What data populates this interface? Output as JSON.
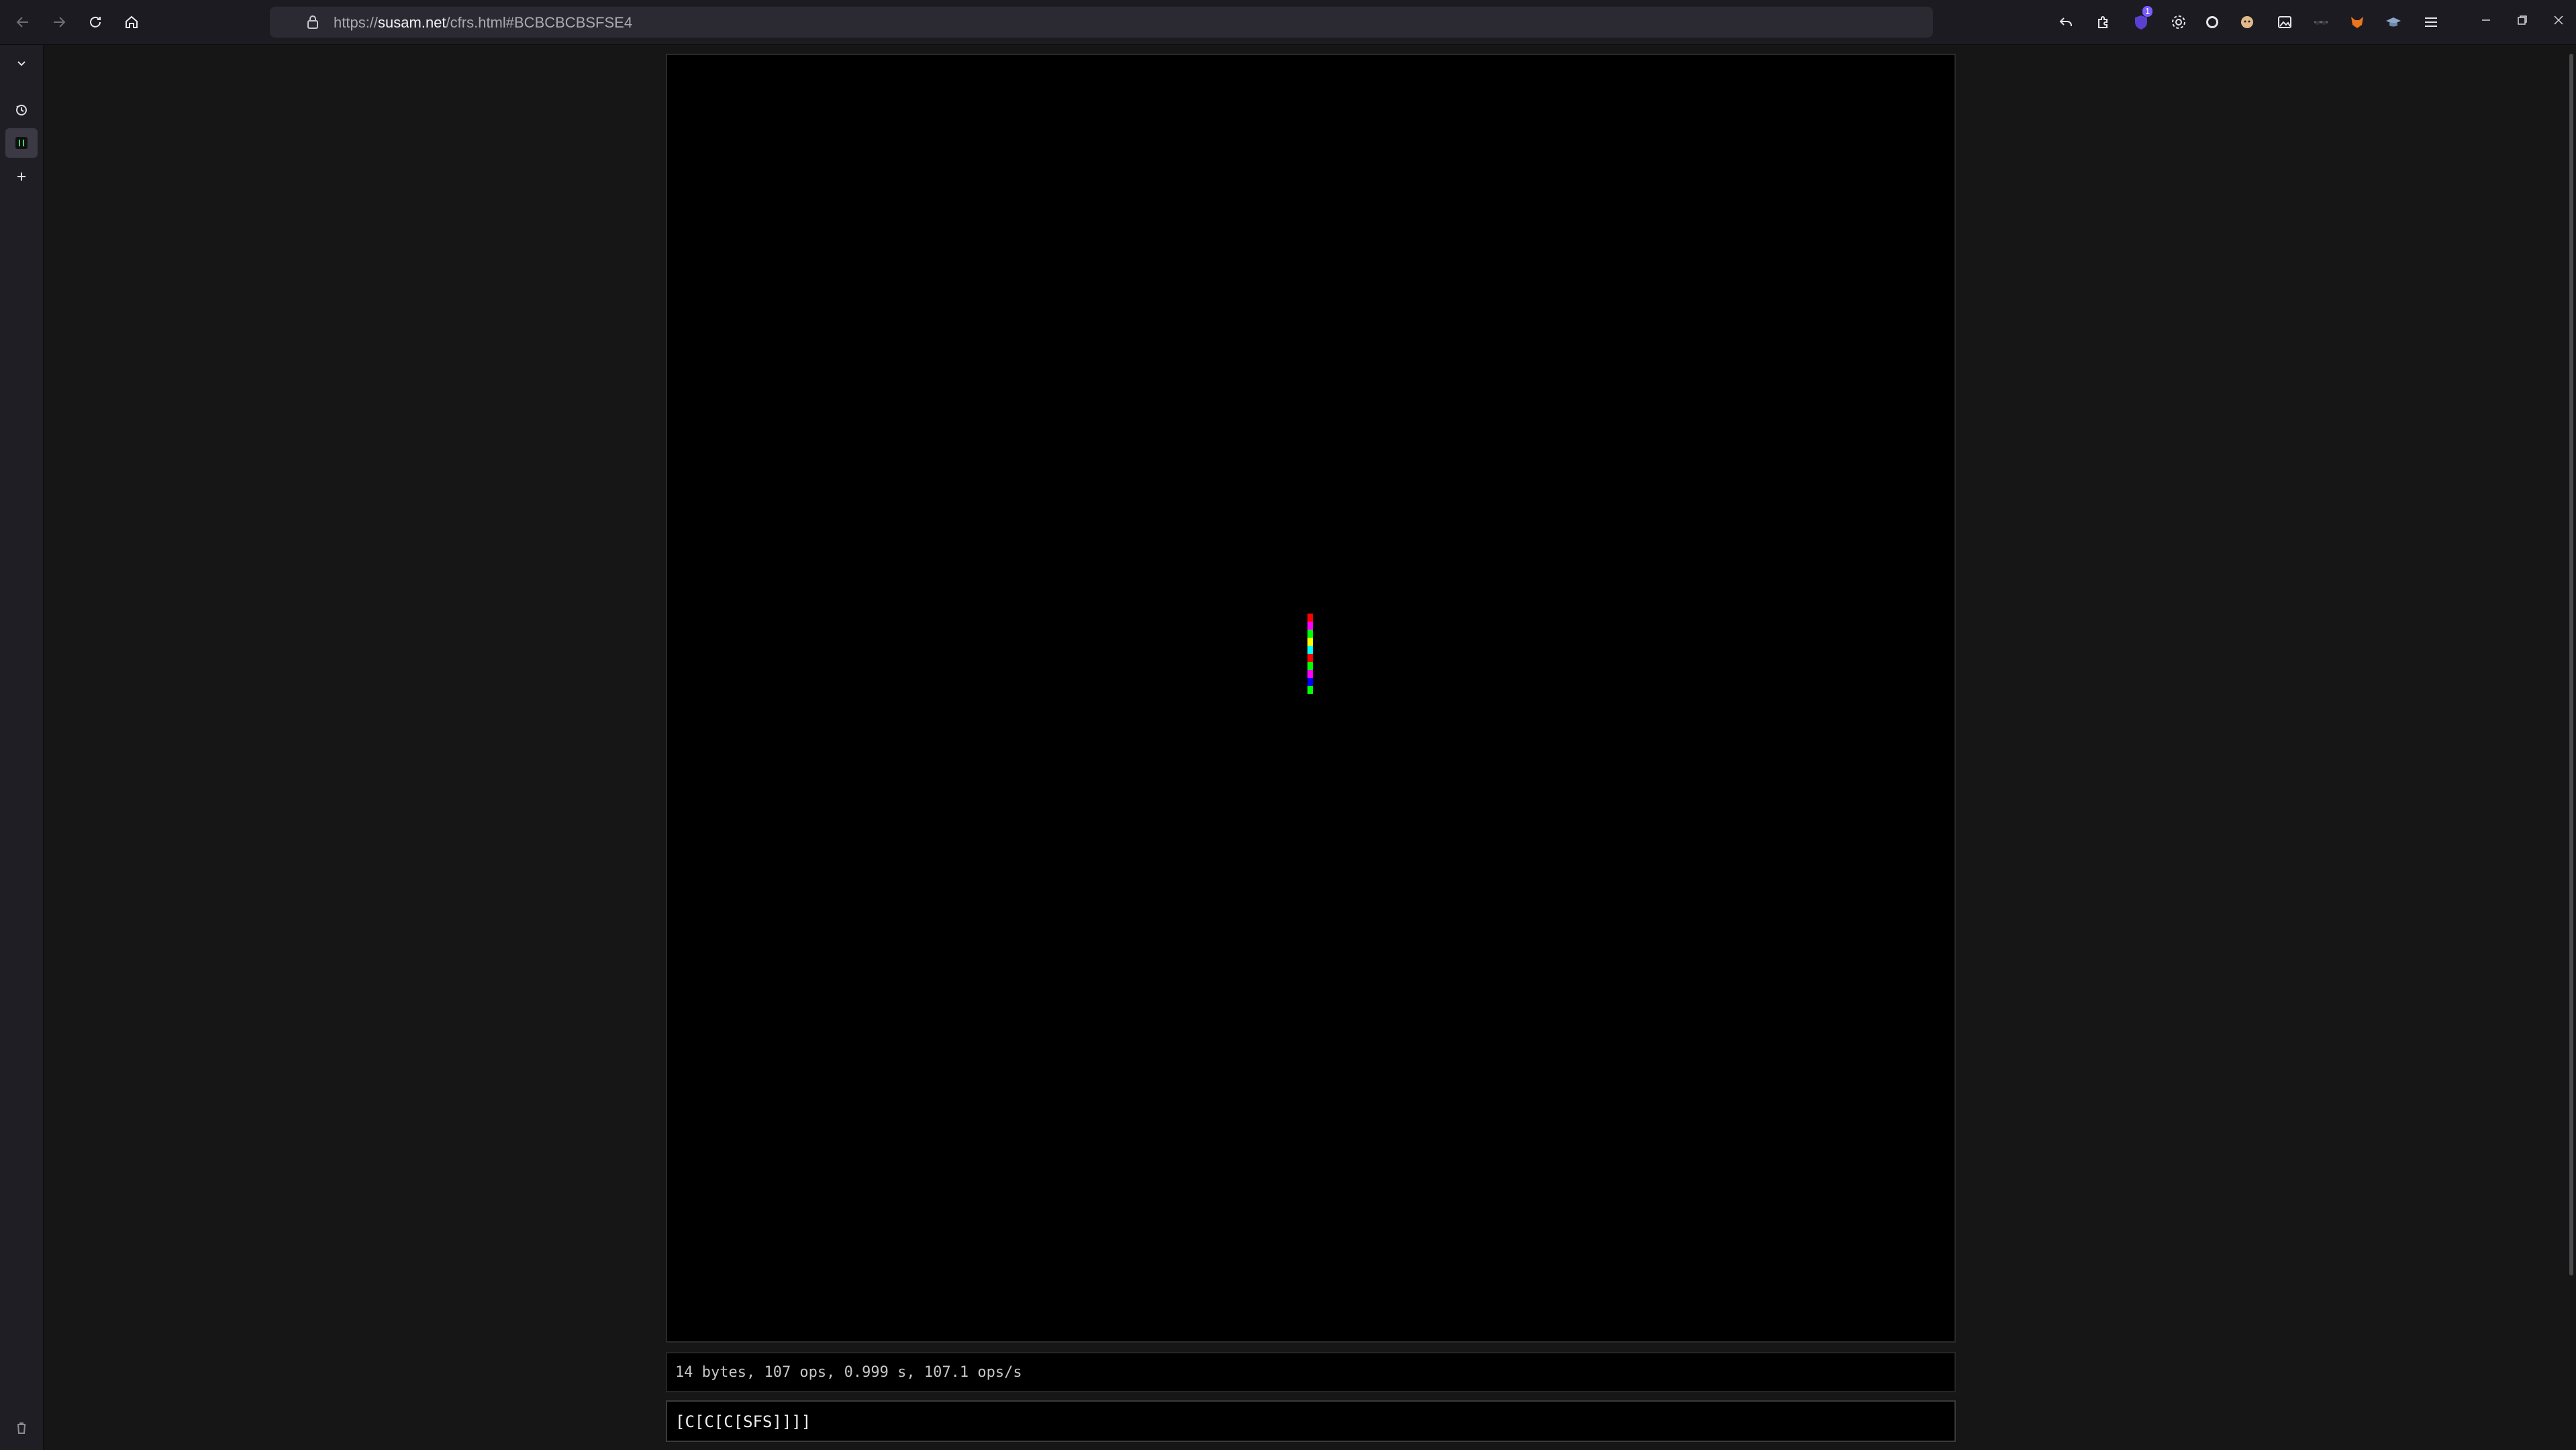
{
  "browser": {
    "url_prefix": "https://",
    "url_host": "susam.net",
    "url_path": "/cfrs.html#BCBCBCBSFSE4",
    "extension_badge": "1"
  },
  "page": {
    "status": "14 bytes, 107 ops, 0.999 s, 107.1 ops/s",
    "code": "[C[C[C[SFS]]]]"
  },
  "drawing": {
    "colors": [
      "#ff0000",
      "#ff00ff",
      "#00ff00",
      "#ffff00",
      "#00ffff",
      "#ff0000",
      "#00ff00",
      "#ff00ff",
      "#0000ff",
      "#00ff00"
    ]
  }
}
